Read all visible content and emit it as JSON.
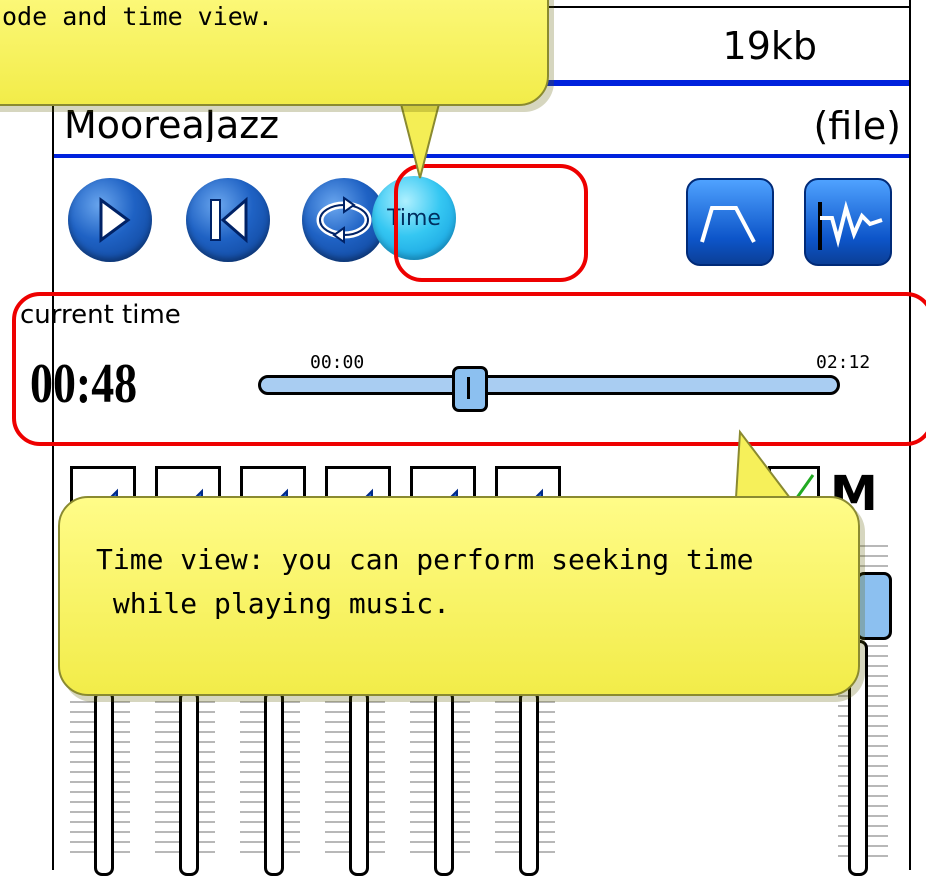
{
  "header": {
    "file_size": "19kb"
  },
  "song": {
    "title": "MooreaJazz",
    "source": "(file)"
  },
  "controls": {
    "play": "play-icon",
    "previous": "skip-previous-icon",
    "repeat": "repeat-icon",
    "time_label": "Time",
    "equalizer": "equalizer-curve-icon",
    "waveform": "waveform-icon"
  },
  "time_view": {
    "label": "current time",
    "current": "00:48",
    "start": "00:00",
    "end": "02:12",
    "progress": 0.364
  },
  "mixer": {
    "channels": [
      "speaker-icon",
      "speaker-icon",
      "speaker-icon",
      "speaker-icon",
      "speaker-icon",
      "speaker-icon"
    ],
    "master_label": "M"
  },
  "callouts": {
    "top": "ode and time view.",
    "bottom": "Time view: you can perform seeking time\n while playing music."
  },
  "colors": {
    "accent_blue": "#0022dd",
    "highlight_red": "#ee0000",
    "callout_yellow": "#f7f160"
  }
}
